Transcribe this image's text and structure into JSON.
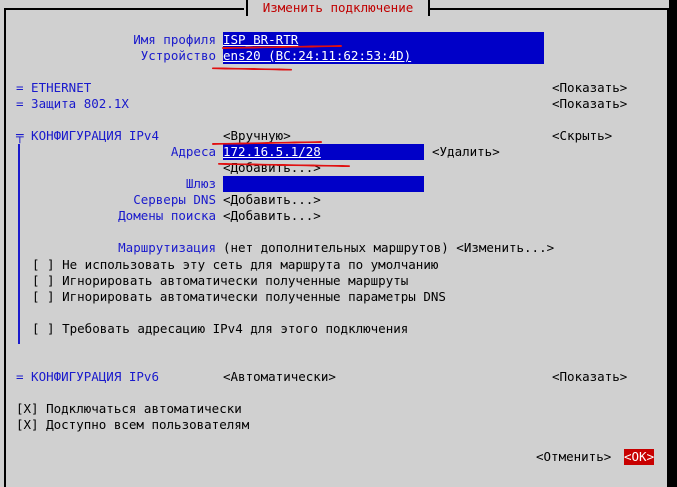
{
  "window": {
    "title": "Изменить подключение"
  },
  "profile": {
    "name_label": "Имя профиля",
    "name_value": "ISP_BR-RTR",
    "device_label": "Устройство",
    "device_value": "ens20 (BC:24:11:62:53:4D)"
  },
  "sections": {
    "ethernet": {
      "label": "= ETHERNET",
      "action": "<Показать>"
    },
    "security": {
      "label": "= Защита 802.1X",
      "action": "<Показать>"
    },
    "ipv4": {
      "label": "╤ КОНФИГУРАЦИЯ IPv4",
      "mode": "<Вручную>",
      "action": "<Скрыть>"
    },
    "ipv6": {
      "label": "= КОНФИГУРАЦИЯ IPv6",
      "mode": "<Автоматически>",
      "action": "<Показать>"
    }
  },
  "ipv4": {
    "addresses_label": "Адреса",
    "address_value": "172.16.5.1/28",
    "remove": "<Удалить>",
    "add_address": "<Добавить...>",
    "gateway_label": "Шлюз",
    "gateway_value": "",
    "dns_label": "Серверы DNS",
    "dns_add": "<Добавить...>",
    "search_label": "Домены поиска",
    "search_add": "<Добавить...>",
    "routing_label": "Маршрутизация",
    "routing_value": "(нет дополнительных маршрутов) <Изменить...>",
    "options": [
      "[ ] Не использовать эту сеть для маршрута по умолчанию",
      "[ ] Игнорировать автоматически полученные маршруты",
      "[ ] Игнорировать автоматически полученные параметры DNS",
      "[ ] Требовать адресацию IPv4 для этого подключения"
    ]
  },
  "general": {
    "autoconnect": "[X] Подключаться автоматически",
    "all_users": "[X] Доступно всем пользователям"
  },
  "buttons": {
    "cancel": "<Отменить>",
    "ok": "<OK>"
  }
}
